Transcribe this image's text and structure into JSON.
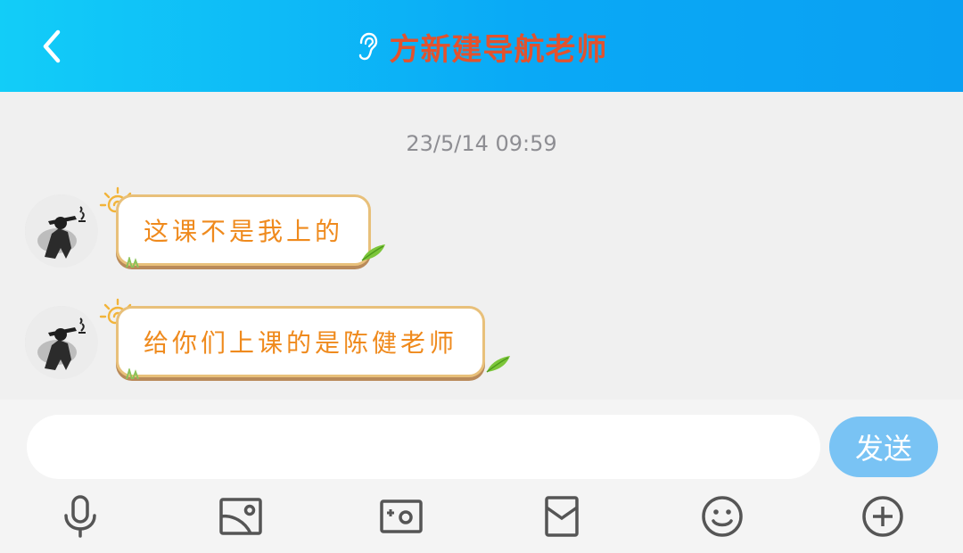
{
  "header": {
    "title": "方新建导航老师",
    "back_icon": "chevron-left-icon",
    "ear_icon": "ear-icon"
  },
  "conversation": {
    "timestamp": "23/5/14 09:59",
    "messages": [
      {
        "text": "这课不是我上的"
      },
      {
        "text": "给你们上课的是陈健老师"
      }
    ]
  },
  "composer": {
    "input_value": "",
    "input_placeholder": "",
    "send_label": "发送"
  },
  "toolbar": {
    "icons": [
      "microphone-icon",
      "image-icon",
      "camera-icon",
      "red-packet-icon",
      "emoji-icon",
      "plus-icon"
    ]
  },
  "colors": {
    "header_start": "#12cdf8",
    "header_end": "#0aa0f2",
    "title": "#e2522e",
    "bubble_text": "#ef8a1d",
    "bubble_border": "#e8c07a",
    "send_button": "#79c3f4"
  }
}
